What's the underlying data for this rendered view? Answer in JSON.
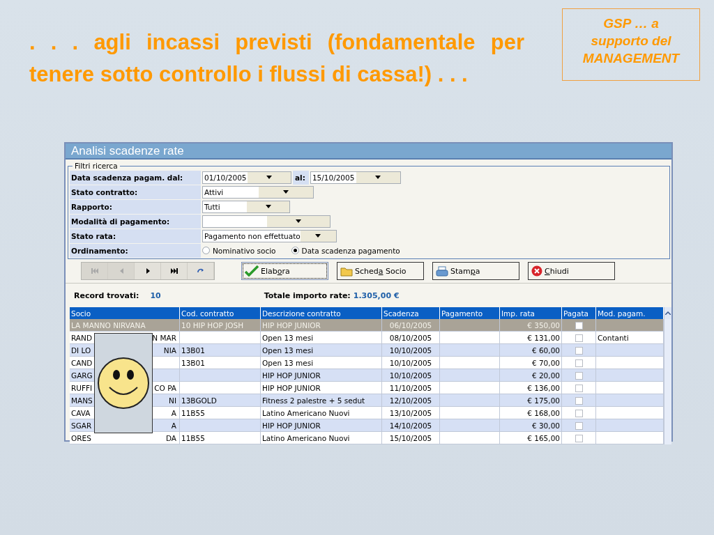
{
  "slide": {
    "heading": ". . . agli incassi previsti (fondamentale per tenere sotto controllo i flussi di cassa!) . . .",
    "callout": [
      "GSP … a",
      "supporto del",
      "MANAGEMENT"
    ]
  },
  "window": {
    "title": "Analisi scadenze rate"
  },
  "filters": {
    "legend": "Filtri ricerca",
    "rows": [
      {
        "kind": "date_range",
        "label": "Data scadenza pagam. dal:",
        "from": "01/10/2005",
        "to_label": "al:",
        "to": "15/10/2005"
      },
      {
        "kind": "select",
        "label": "Stato contratto:",
        "value": "Attivi"
      },
      {
        "kind": "select",
        "label": "Rapporto:",
        "value": "Tutti"
      },
      {
        "kind": "select",
        "label": "Modalità di pagamento:"
      },
      {
        "kind": "select",
        "label": "Stato rata:",
        "value": "Pagamento non effettuato"
      },
      {
        "kind": "radio",
        "label": "Ordinamento:",
        "options": [
          {
            "label": "Nominativo socio",
            "selected": false
          },
          {
            "label": "Data scadenza pagamento",
            "selected": true
          }
        ]
      }
    ]
  },
  "nav_buttons": [
    {
      "kind": "first",
      "disabled": true
    },
    {
      "kind": "prev",
      "disabled": true
    },
    {
      "kind": "next",
      "disabled": false
    },
    {
      "kind": "last",
      "disabled": false
    },
    {
      "kind": "refresh",
      "disabled": false
    }
  ],
  "actions": [
    {
      "kind": "check",
      "before": "Elab",
      "key": "o",
      "after": "ra",
      "focused": true
    },
    {
      "kind": "folder",
      "before": "Sched",
      "key": "a",
      "after": " Socio",
      "focused": false
    },
    {
      "kind": "printer",
      "before": "Stam",
      "key": "p",
      "after": "a",
      "focused": false
    },
    {
      "kind": "close",
      "key": "C",
      "after": "hiudi",
      "focused": false
    }
  ],
  "summary": {
    "records_label": "Record trovati:",
    "records": "10",
    "total_label": "Totale importo rate:",
    "total": "1.305,00 €"
  },
  "table": {
    "columns": [
      "Socio",
      "Cod. contratto",
      "Descrizione contratto",
      "Scadenza",
      "Pagamento",
      "Imp. rata",
      "Pagata",
      "Mod. pagam."
    ],
    "rows": [
      {
        "socio": "LA MANNO NIRVANA",
        "cod": "10 HIP HOP JOSH",
        "descr": "HIP HOP JUNIOR",
        "scadenza": "06/10/2005",
        "importo": "€ 350,00",
        "pagata": false,
        "mod": "",
        "selected": true
      },
      {
        "socio": "RAND",
        "socio_end": "N MAR",
        "cod": "",
        "descr": "Open 13 mesi",
        "scadenza": "08/10/2005",
        "importo": "€ 131,00",
        "pagata": false,
        "mod": "Contanti",
        "selected": false
      },
      {
        "socio": "DI LO",
        "socio_end": "NIA",
        "cod": "13B01",
        "descr": "Open 13 mesi",
        "scadenza": "10/10/2005",
        "importo": "€ 60,00",
        "pagata": false,
        "mod": "",
        "selected": false
      },
      {
        "socio": "CAND",
        "cod": "13B01",
        "descr": "Open 13 mesi",
        "scadenza": "10/10/2005",
        "importo": "€ 70,00",
        "pagata": false,
        "mod": "",
        "selected": false
      },
      {
        "socio": "GARG",
        "cod": "",
        "descr": "HIP HOP JUNIOR",
        "scadenza": "10/10/2005",
        "importo": "€ 20,00",
        "pagata": false,
        "mod": "",
        "selected": false
      },
      {
        "socio": "RUFFI",
        "socio_end": "CO PA",
        "cod": "",
        "descr": "HIP HOP JUNIOR",
        "scadenza": "11/10/2005",
        "importo": "€ 136,00",
        "pagata": false,
        "mod": "",
        "selected": false
      },
      {
        "socio": "MANS",
        "socio_end": "NI",
        "cod": "13BGOLD",
        "descr": "Fitness 2 palestre + 5 sedut",
        "scadenza": "12/10/2005",
        "importo": "€ 175,00",
        "pagata": false,
        "mod": "",
        "selected": false
      },
      {
        "socio": "CAVA",
        "socio_end": "A",
        "cod": "11B55",
        "descr": "Latino Americano Nuovi",
        "scadenza": "13/10/2005",
        "importo": "€ 168,00",
        "pagata": false,
        "mod": "",
        "selected": false
      },
      {
        "socio": "SGAR",
        "socio_end": "A",
        "cod": "",
        "descr": "HIP HOP JUNIOR",
        "scadenza": "14/10/2005",
        "importo": "€ 30,00",
        "pagata": false,
        "mod": "",
        "selected": false
      },
      {
        "socio": "ORES",
        "socio_end": "DA",
        "cod": "11B55",
        "descr": "Latino Americano Nuovi",
        "scadenza": "15/10/2005",
        "importo": "€ 165,00",
        "pagata": false,
        "mod": "",
        "selected": false
      }
    ]
  }
}
